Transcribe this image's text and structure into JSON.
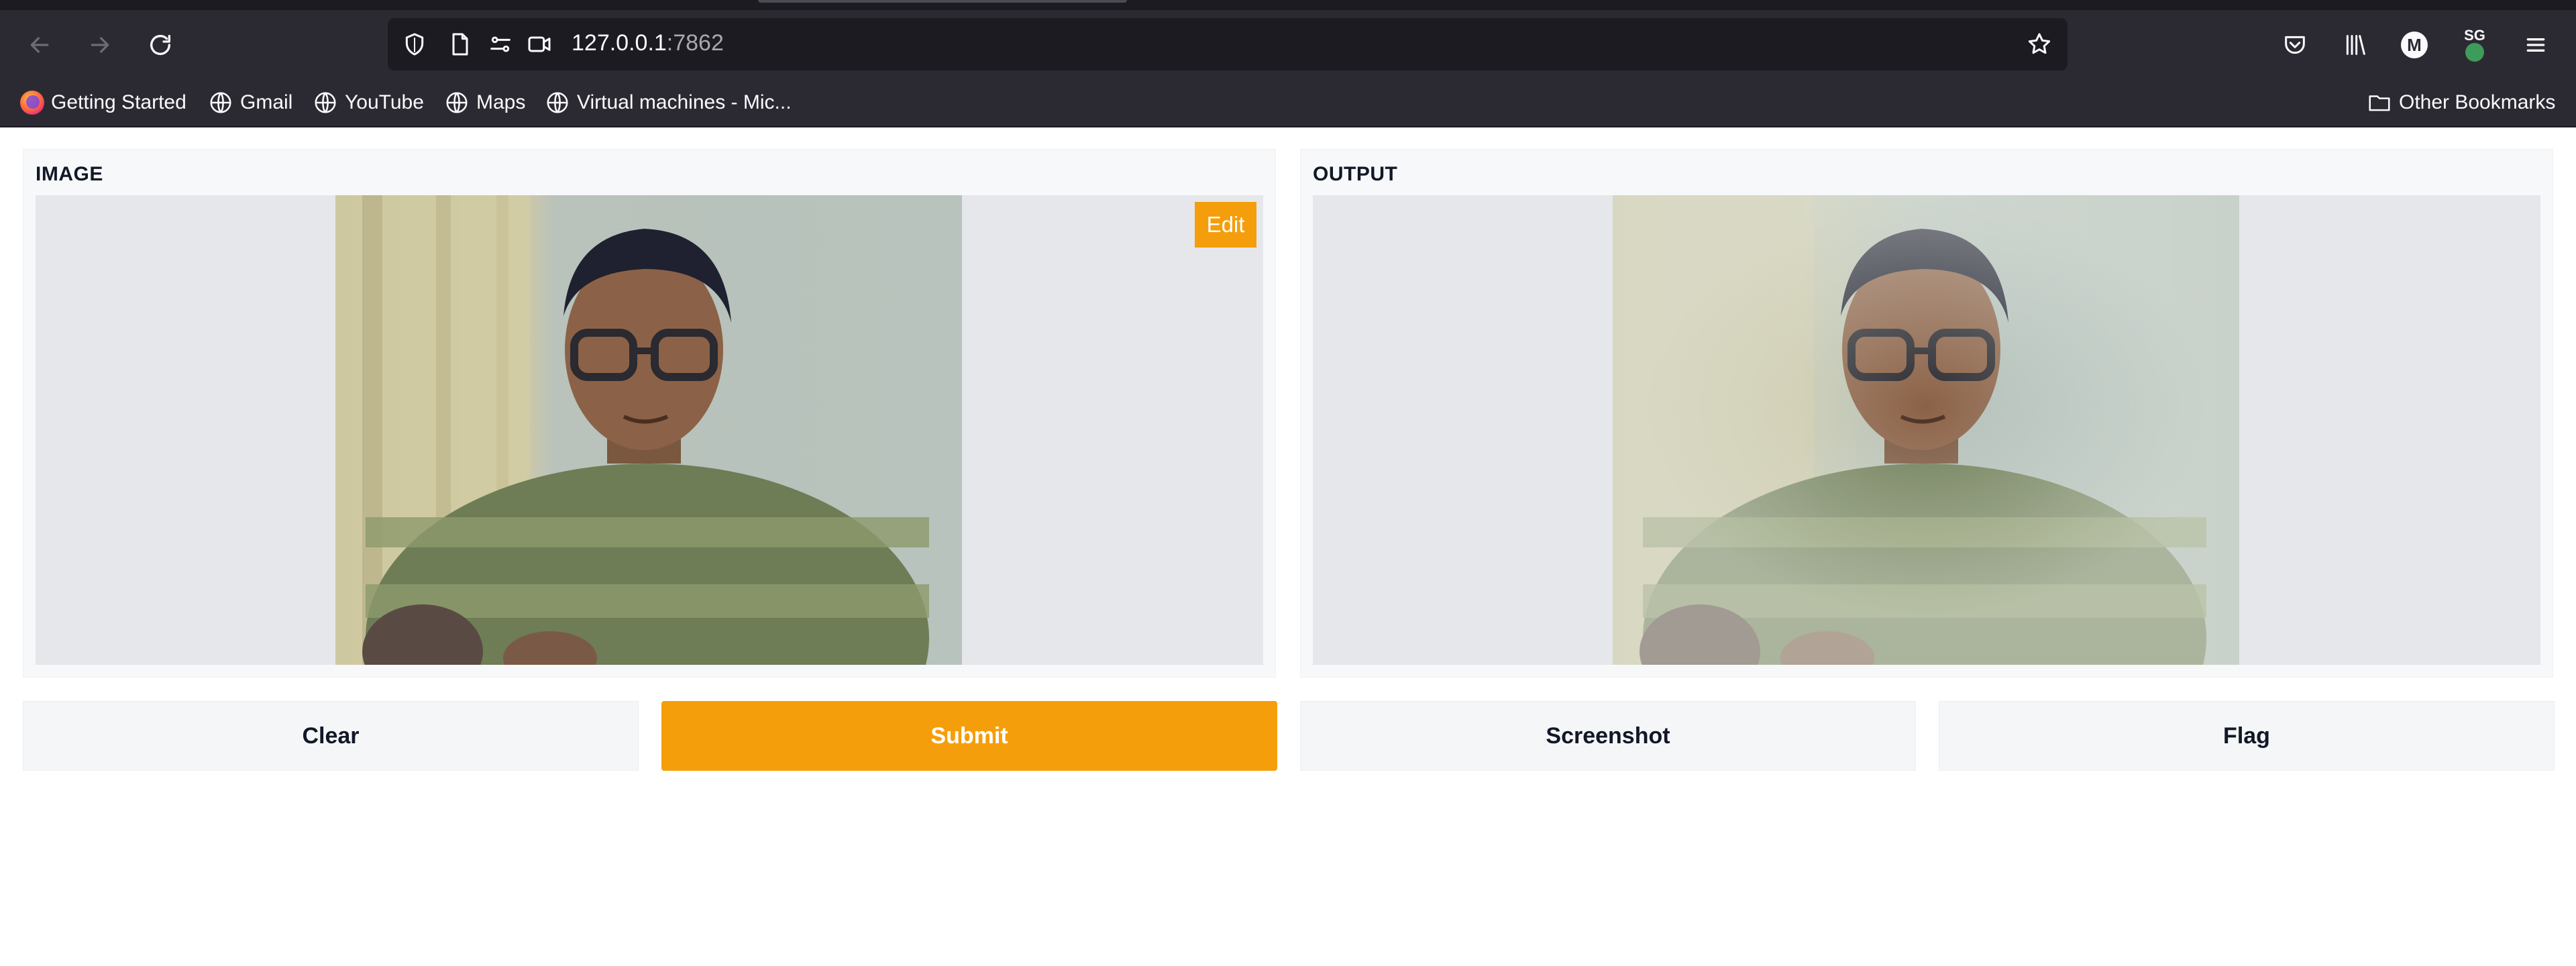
{
  "browser": {
    "url_host": "127.0.0.1",
    "url_port": ":7862",
    "bookmarks": [
      "Getting Started",
      "Gmail",
      "YouTube",
      "Maps",
      "Virtual machines - Mic..."
    ],
    "other_bookmarks": "Other Bookmarks",
    "account_initial": "M",
    "extension_badge": "SG",
    "icons": [
      "back-icon",
      "forward-icon",
      "reload-icon",
      "shield-icon",
      "page-icon",
      "permissions-icon",
      "camera-icon",
      "star-icon",
      "pocket-icon",
      "library-icon",
      "menu-icon",
      "folder-icon",
      "globe-icon"
    ]
  },
  "app": {
    "input_label": "IMAGE",
    "output_label": "OUTPUT",
    "edit_label": "Edit",
    "buttons": {
      "clear": "Clear",
      "submit": "Submit",
      "screenshot": "Screenshot",
      "flag": "Flag"
    },
    "colors": {
      "accent": "#f59e0b",
      "panel_bg": "#f7f8fa",
      "image_bg": "#e5e7eb",
      "chrome_bg": "#2b2a33"
    }
  }
}
